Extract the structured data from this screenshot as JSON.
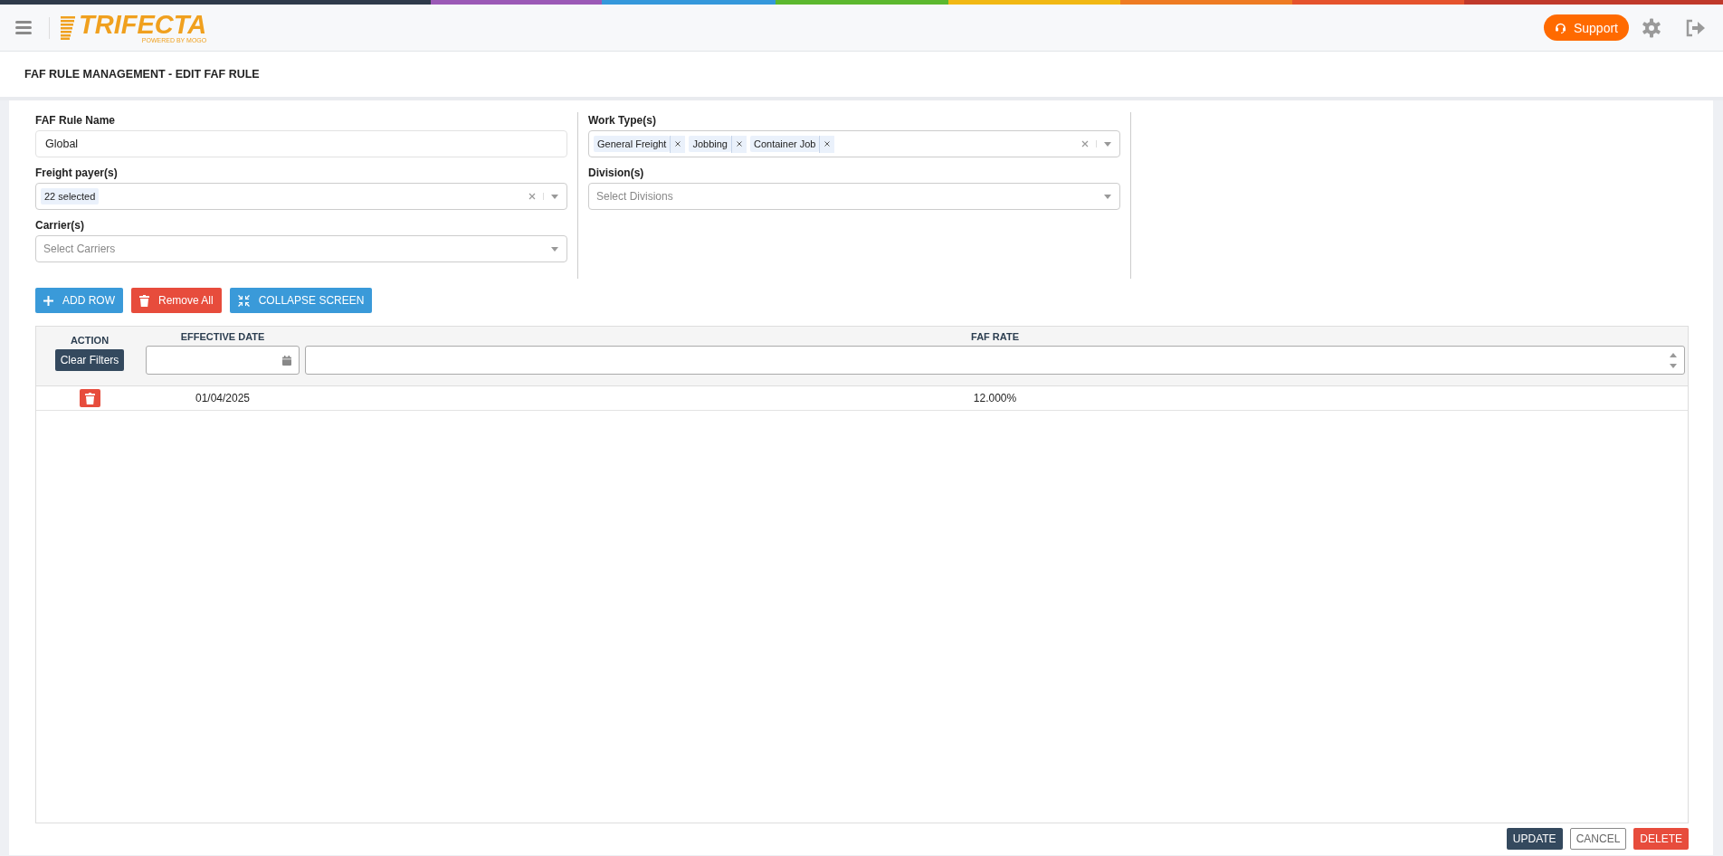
{
  "header": {
    "logo_name": "TRIFECTA",
    "logo_tagline": "POWERED BY MOGO",
    "support_button": "Support"
  },
  "page_title": "FAF RULE MANAGEMENT - EDIT FAF RULE",
  "form": {
    "columns": [
      {
        "fields": [
          {
            "kind": "text",
            "label": "FAF Rule Name",
            "value": "Global"
          },
          {
            "kind": "multiselect",
            "label": "Freight payer(s)",
            "clearable": true,
            "tags": [
              {
                "label": "22 selected",
                "removable": false
              }
            ]
          },
          {
            "kind": "select",
            "label": "Carrier(s)",
            "placeholder": "Select Carriers"
          }
        ]
      },
      {
        "fields": [
          {
            "kind": "multiselect",
            "label": "Work Type(s)",
            "clearable": true,
            "tags": [
              {
                "label": "General Freight",
                "removable": true
              },
              {
                "label": "Jobbing",
                "removable": true
              },
              {
                "label": "Container Job",
                "removable": true
              }
            ]
          },
          {
            "kind": "select",
            "label": "Division(s)",
            "placeholder": "Select Divisions"
          }
        ]
      }
    ]
  },
  "toolbar": [
    {
      "kind": "add",
      "label": "ADD ROW"
    },
    {
      "kind": "remove",
      "label": "Remove All"
    },
    {
      "kind": "collapse",
      "label": "COLLAPSE SCREEN"
    }
  ],
  "table": {
    "columns": [
      {
        "label": "ACTION",
        "kind": "action",
        "filter_label": "Clear Filters"
      },
      {
        "label": "EFFECTIVE DATE",
        "kind": "date"
      },
      {
        "label": "FAF RATE",
        "kind": "number"
      }
    ],
    "rows": [
      {
        "effective_date": "01/04/2025",
        "faf_rate": "12.000%"
      }
    ]
  },
  "footer_buttons": [
    {
      "kind": "primary",
      "label": "UPDATE"
    },
    {
      "kind": "outline",
      "label": "CANCEL"
    },
    {
      "kind": "danger",
      "label": "DELETE"
    }
  ]
}
